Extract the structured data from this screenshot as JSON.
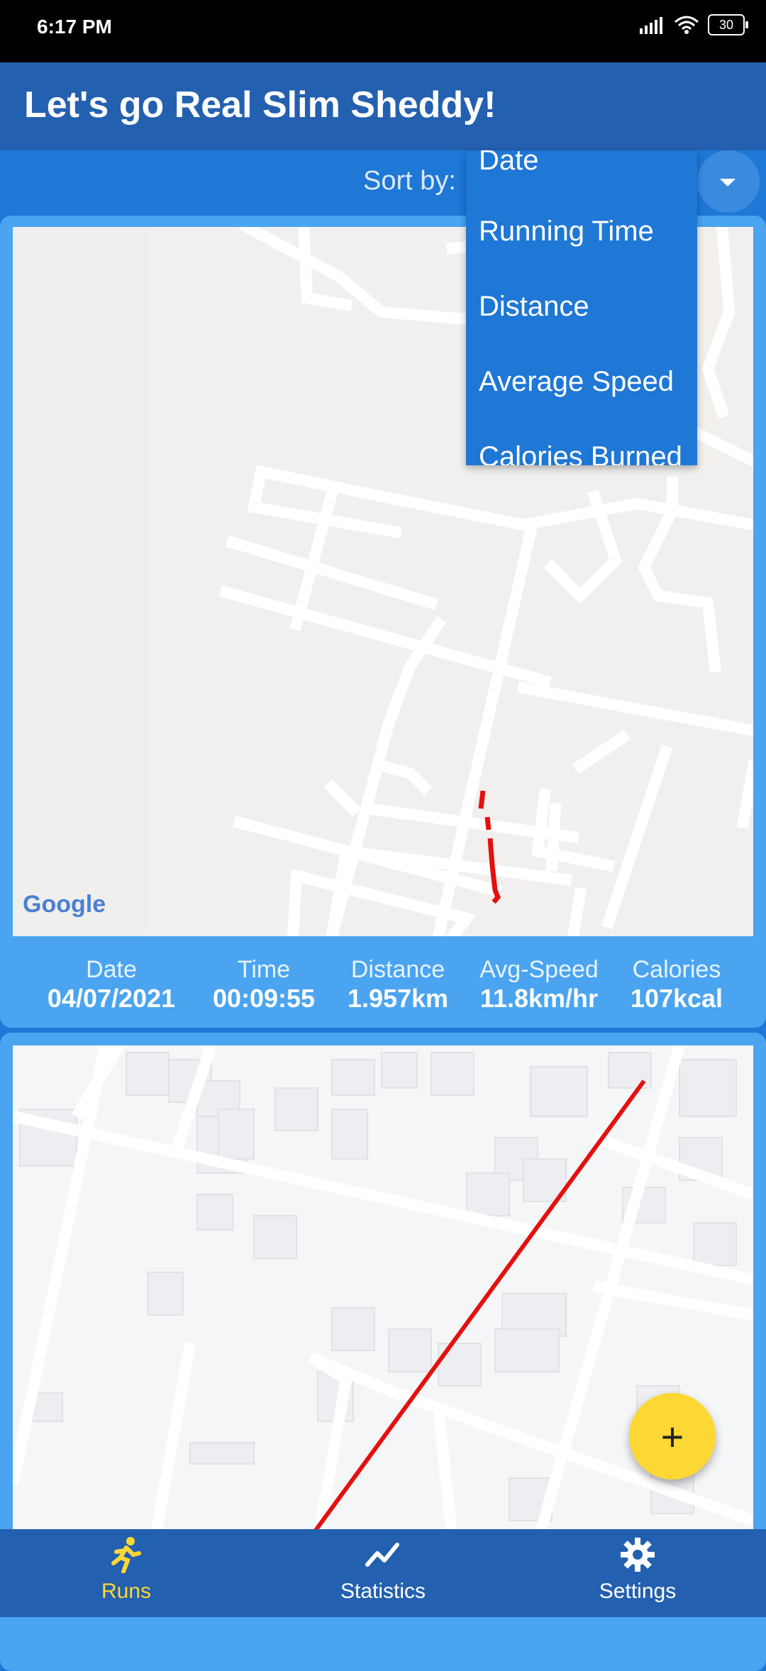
{
  "status_bar": {
    "time": "6:17 PM",
    "battery": "30"
  },
  "app_bar": {
    "title": "Let's go Real Slim Sheddy!"
  },
  "sort": {
    "label": "Sort by:",
    "options": [
      "Date",
      "Running Time",
      "Distance",
      "Average Speed",
      "Calories Burned"
    ]
  },
  "runs": [
    {
      "map_attribution": "Google",
      "stats": [
        {
          "label": "Date",
          "value": "04/07/2021"
        },
        {
          "label": "Time",
          "value": "00:09:55"
        },
        {
          "label": "Distance",
          "value": "1.957km"
        },
        {
          "label": "Avg-Speed",
          "value": "11.8km/hr"
        },
        {
          "label": "Calories",
          "value": "107kcal"
        }
      ]
    }
  ],
  "fab": {
    "label": "+"
  },
  "bottom_nav": [
    {
      "label": "Runs",
      "icon": "runner-icon",
      "active": true
    },
    {
      "label": "Statistics",
      "icon": "chart-line-icon",
      "active": false
    },
    {
      "label": "Settings",
      "icon": "gear-icon",
      "active": false
    }
  ],
  "colors": {
    "primary": "#2460b0",
    "accent": "#fdd835",
    "route": "#e41010",
    "card": "#4aa4f0"
  }
}
